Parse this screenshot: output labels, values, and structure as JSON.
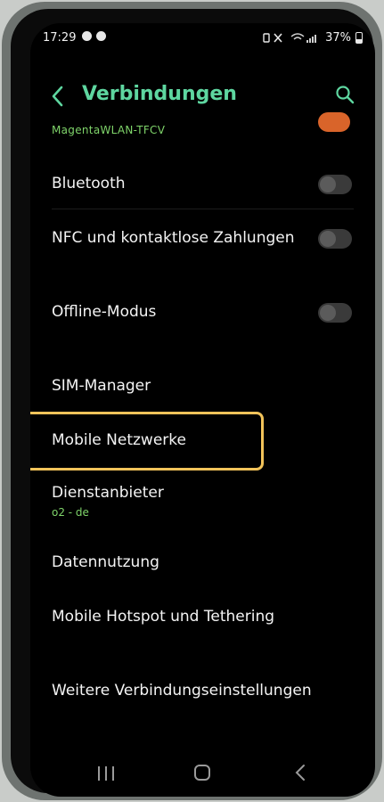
{
  "status_bar": {
    "time": "17:29",
    "battery": "37%"
  },
  "header": {
    "title": "Verbindungen"
  },
  "wlan": {
    "network": "MagentaWLAN-TFCV"
  },
  "settings": [
    {
      "label": "Bluetooth",
      "toggle": "off"
    },
    {
      "label": "NFC und kontaktlose Zahlungen",
      "toggle": "off"
    },
    {
      "label": "Offline-Modus",
      "toggle": "off"
    },
    {
      "label": "SIM-Manager"
    },
    {
      "label": "Mobile Netzwerke",
      "highlighted": true
    },
    {
      "label": "Dienstanbieter",
      "sub": "o2 - de"
    },
    {
      "label": "Datennutzung"
    },
    {
      "label": "Mobile Hotspot und Tethering"
    },
    {
      "label": "Weitere Verbindungseinstellungen"
    }
  ],
  "colors": {
    "accent": "#5ed6a0",
    "subtext": "#7fd46a",
    "highlight": "#f2c35a",
    "wlan_toggle": "#d9642a"
  },
  "icons": [
    "back-icon",
    "search-icon",
    "recents-icon",
    "home-icon",
    "nav-back-icon"
  ]
}
